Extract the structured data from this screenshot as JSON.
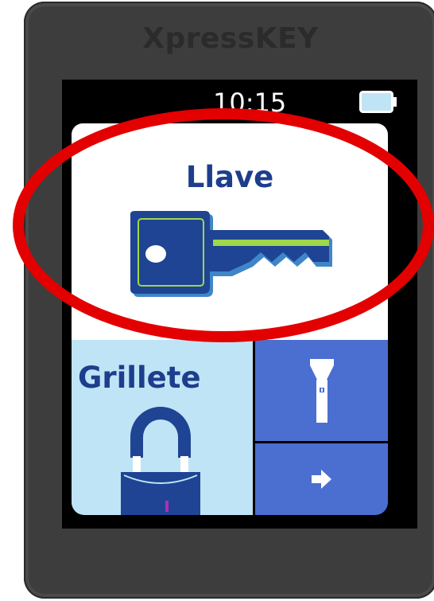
{
  "device": {
    "brand": "XpressKEY"
  },
  "status_bar": {
    "time": "10:15",
    "battery_icon": "battery-icon"
  },
  "menu": {
    "key_tile": {
      "label": "Llave",
      "icon": "key-icon"
    },
    "shackle_tile": {
      "label": "Grillete",
      "icon": "padlock-icon"
    },
    "flashlight_tile": {
      "icon": "flashlight-icon"
    },
    "next_tile": {
      "icon": "arrow-right-icon"
    }
  },
  "annotation": {
    "highlight": "red-ellipse",
    "color": "#e30000"
  },
  "colors": {
    "navy": "#1d3e8c",
    "tile_blue": "#4a6fd0",
    "tile_light": "#bfe4f6",
    "key_blue": "#1e4493",
    "key_green": "#9fd64a",
    "device_body": "#3d3d3d"
  }
}
